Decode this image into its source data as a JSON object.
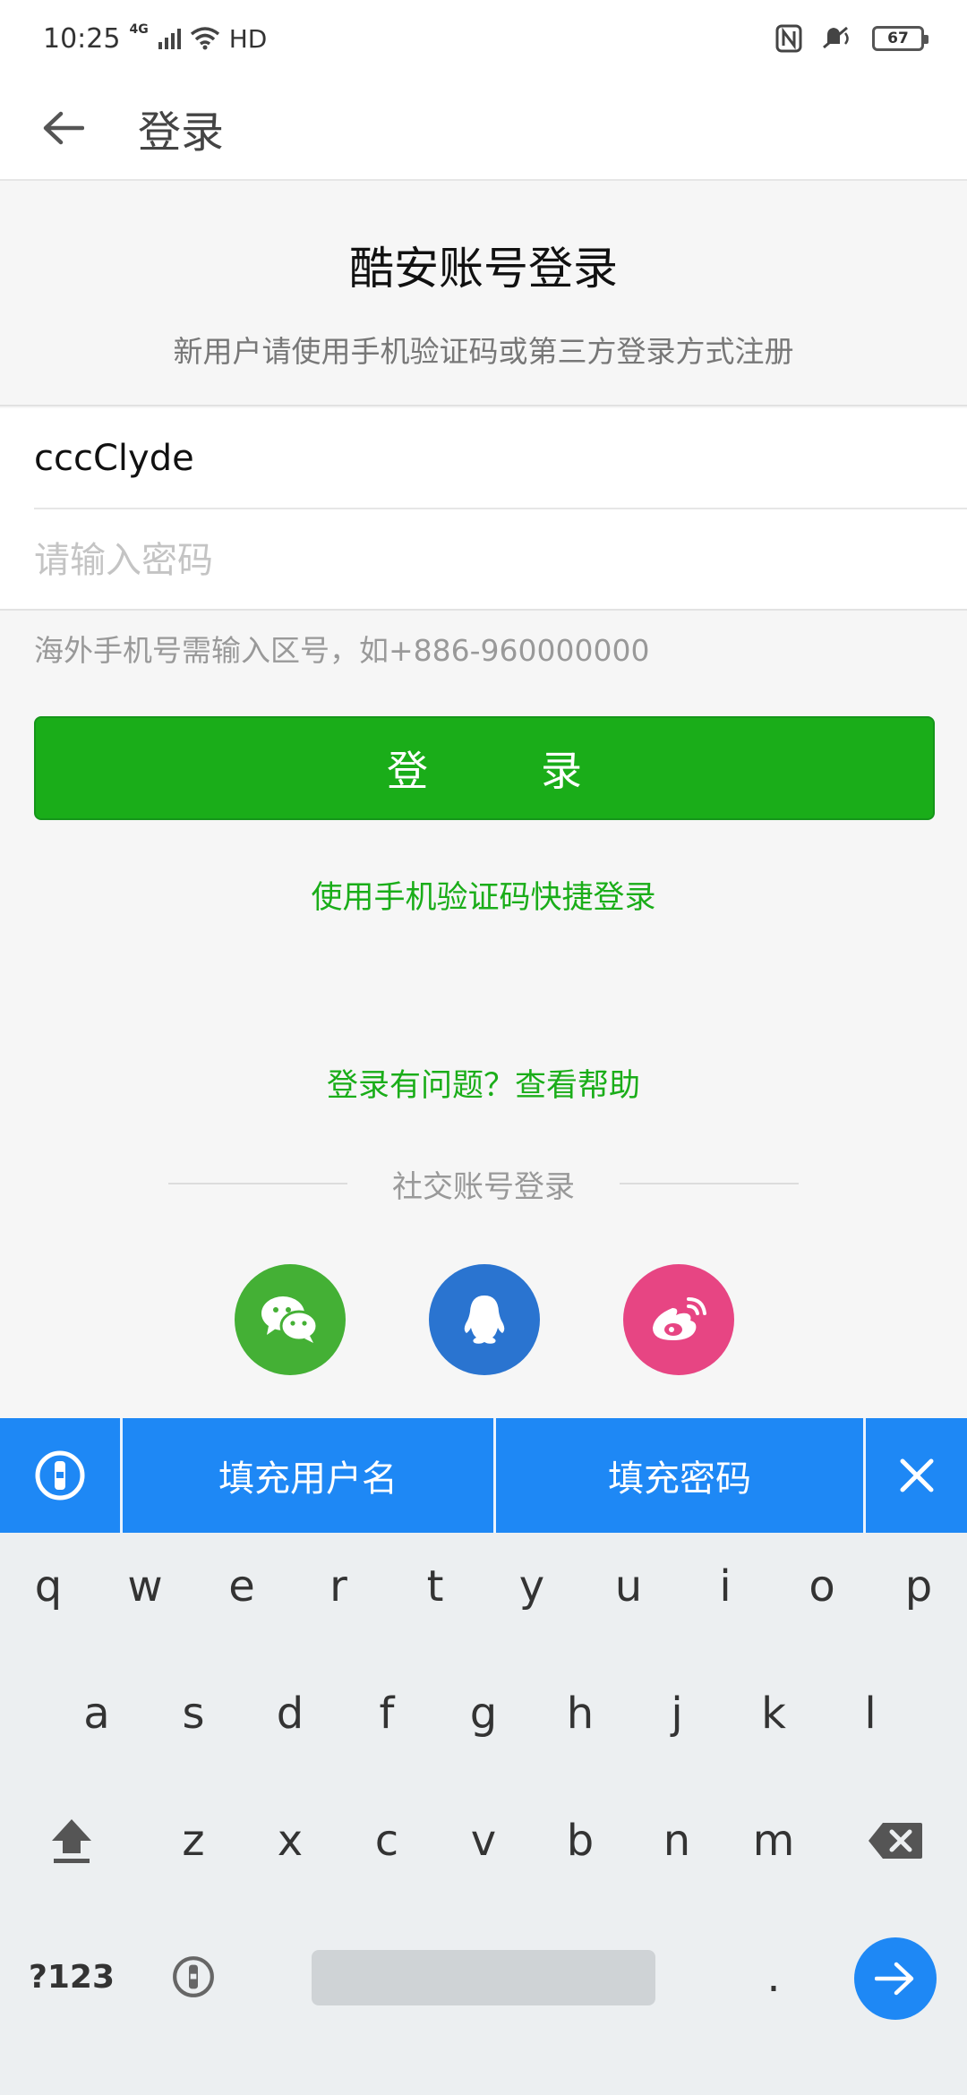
{
  "status_bar": {
    "time": "10:25",
    "network": "4G",
    "hd": "HD",
    "battery": "67"
  },
  "app_bar": {
    "title": "登录"
  },
  "header": {
    "title": "酷安账号登录",
    "subtitle": "新用户请使用手机验证码或第三方登录方式注册"
  },
  "form": {
    "username_value": "cccClyde",
    "password_placeholder": "请输入密码",
    "hint": "海外手机号需输入区号，如+886-960000000",
    "login_button": "登　录",
    "sms_login_link": "使用手机验证码快捷登录",
    "help_link": "登录有问题？查看帮助"
  },
  "social": {
    "label": "社交账号登录",
    "providers": [
      "wechat-icon",
      "qq-icon",
      "weibo-icon"
    ]
  },
  "autofill": {
    "fill_username": "填充用户名",
    "fill_password": "填充密码"
  },
  "keyboard": {
    "row1": [
      "q",
      "w",
      "e",
      "r",
      "t",
      "y",
      "u",
      "i",
      "o",
      "p"
    ],
    "row2": [
      "a",
      "s",
      "d",
      "f",
      "g",
      "h",
      "j",
      "k",
      "l"
    ],
    "row3": [
      "z",
      "x",
      "c",
      "v",
      "b",
      "n",
      "m"
    ],
    "symbols": "?123",
    "period": "."
  },
  "colors": {
    "primary_green": "#1aad19",
    "autofill_blue": "#1e88f5",
    "wechat": "#44b035",
    "qq": "#2a74d0",
    "weibo": "#e74583"
  }
}
